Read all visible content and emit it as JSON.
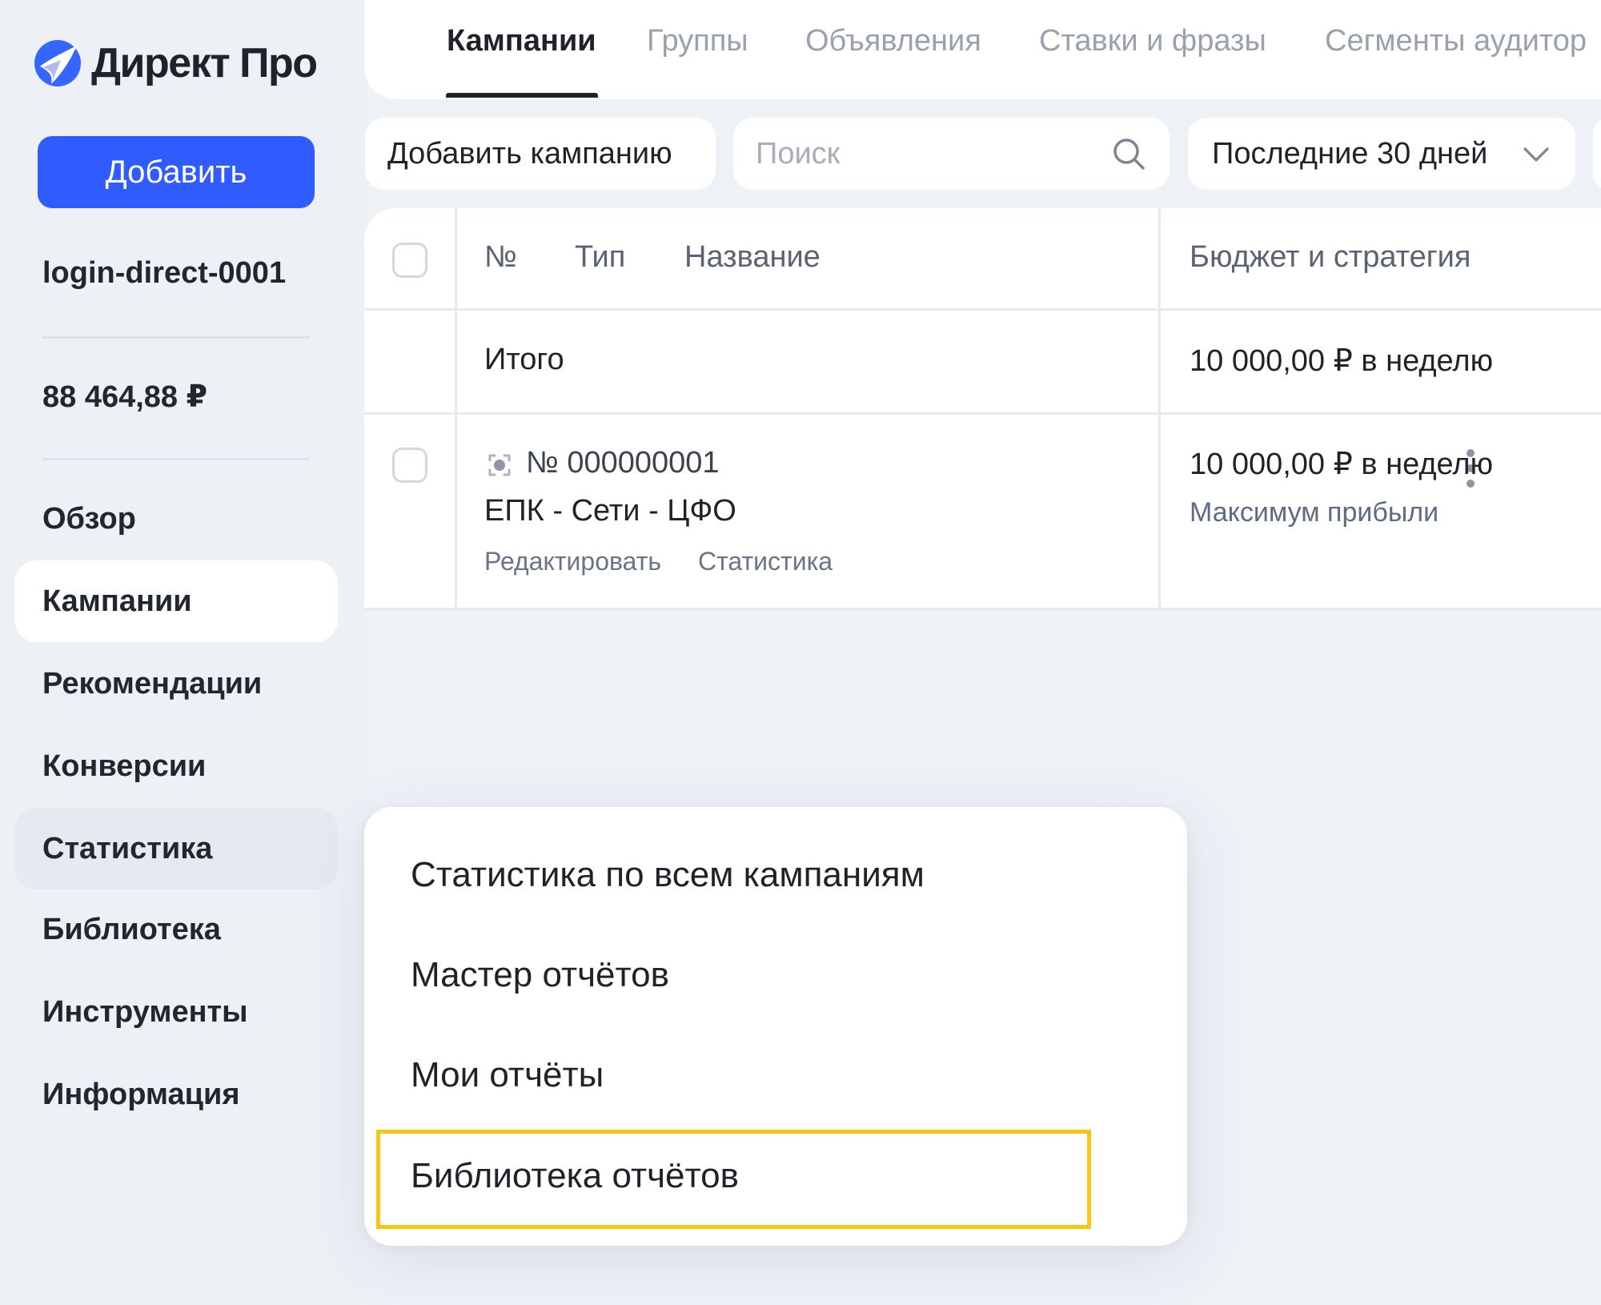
{
  "app": {
    "logo_text": "Директ Про",
    "brand_color": "#2f5bff",
    "highlight_color": "#f5c518"
  },
  "sidebar": {
    "add_button": "Добавить",
    "login": "login-direct-0001",
    "balance": "88 464,88 ₽",
    "items": [
      {
        "label": "Обзор"
      },
      {
        "label": "Кампании"
      },
      {
        "label": "Рекомендации"
      },
      {
        "label": "Конверсии"
      },
      {
        "label": "Статистика"
      },
      {
        "label": "Библиотека"
      },
      {
        "label": "Инструменты"
      },
      {
        "label": "Информация"
      }
    ]
  },
  "tabs": [
    {
      "label": "Кампании",
      "active": true
    },
    {
      "label": "Группы"
    },
    {
      "label": "Объявления"
    },
    {
      "label": "Ставки и фразы"
    },
    {
      "label": "Сегменты аудитор"
    }
  ],
  "toolbar": {
    "add_campaign": "Добавить кампанию",
    "search_placeholder": "Поиск",
    "period": "Последние 30 дней"
  },
  "table": {
    "headers": {
      "number": "№",
      "type": "Тип",
      "name": "Название",
      "budget": "Бюджет и стратегия"
    },
    "total_row": {
      "label": "Итого",
      "budget": "10 000,00 ₽ в неделю"
    },
    "rows": [
      {
        "number": "№ 000000001",
        "name": "ЕПК - Сети - ЦФО",
        "edit_link": "Редактировать",
        "stats_link": "Статистика",
        "budget": "10 000,00 ₽ в неделю",
        "strategy": "Максимум прибыли"
      }
    ]
  },
  "stats_menu": {
    "items": [
      {
        "label": "Статистика по всем кампаниям"
      },
      {
        "label": "Мастер отчётов"
      },
      {
        "label": "Мои отчёты"
      },
      {
        "label": "Библиотека отчётов",
        "highlighted": true
      }
    ]
  }
}
